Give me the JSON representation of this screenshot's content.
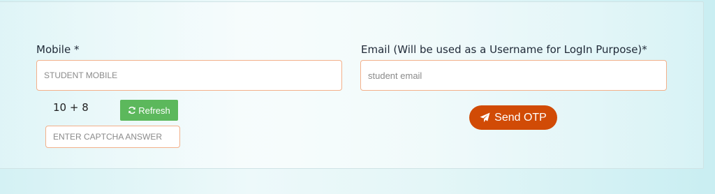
{
  "form": {
    "mobile": {
      "label": "Mobile *",
      "placeholder": "STUDENT MOBILE"
    },
    "email": {
      "label": "Email (Will be used as a Username for LogIn Purpose)*",
      "placeholder": "student email"
    },
    "captcha": {
      "question": "10 + 8",
      "refresh_label": "Refresh",
      "answer_placeholder": "ENTER CAPTCHA ANSWER"
    },
    "send_otp_label": "Send OTP"
  },
  "colors": {
    "input_border": "#f3b08a",
    "refresh_button": "#5cb85c",
    "send_otp_button": "#d14b06"
  },
  "icons": {
    "refresh": "refresh-icon",
    "send": "paper-plane-icon"
  }
}
